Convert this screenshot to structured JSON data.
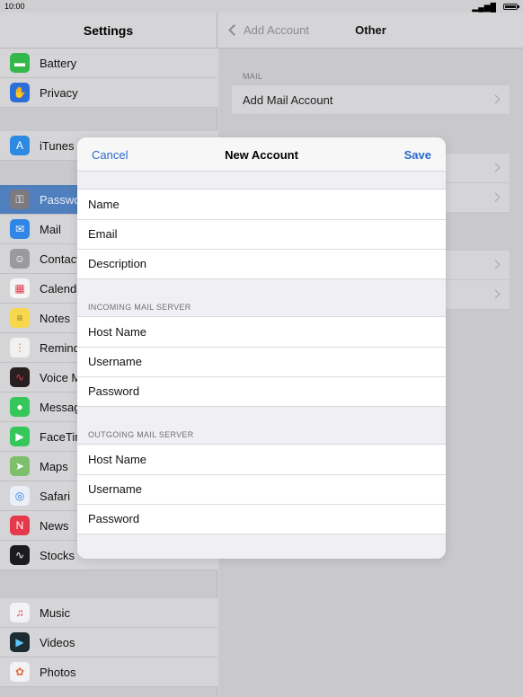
{
  "status": {
    "time": "10:00",
    "signal": "▂▄▆█"
  },
  "left": {
    "title": "Settings",
    "items": [
      {
        "label": "Battery",
        "icon": "battery-icon",
        "color": "#34b84c",
        "glyph": "▬"
      },
      {
        "label": "Privacy",
        "icon": "hand-icon",
        "color": "#2d6fd8",
        "glyph": "✋"
      },
      {
        "label": "iTunes & App Store",
        "icon": "app-store-icon",
        "color": "#2d8ae0",
        "glyph": "A"
      },
      {
        "label": "Passwords & Accounts",
        "icon": "key-icon",
        "color": "#7a7a80",
        "glyph": "⚿"
      },
      {
        "label": "Mail",
        "icon": "mail-icon",
        "color": "#2f86e6",
        "glyph": "✉"
      },
      {
        "label": "Contacts",
        "icon": "contacts-icon",
        "color": "#9a9a9e",
        "glyph": "☺"
      },
      {
        "label": "Calendar",
        "icon": "calendar-icon",
        "color": "#f4f4f4",
        "glyph": "▦"
      },
      {
        "label": "Notes",
        "icon": "notes-icon",
        "color": "#f7d74c",
        "glyph": "≡"
      },
      {
        "label": "Reminders",
        "icon": "reminders-icon",
        "color": "#f1f1f1",
        "glyph": "⋮"
      },
      {
        "label": "Voice Memos",
        "icon": "voice-memo-icon",
        "color": "#2a1f20",
        "glyph": "∿"
      },
      {
        "label": "Messages",
        "icon": "messages-icon",
        "color": "#35c759",
        "glyph": "💬"
      },
      {
        "label": "FaceTime",
        "icon": "facetime-icon",
        "color": "#35c759",
        "glyph": "▶"
      },
      {
        "label": "Maps",
        "icon": "maps-icon",
        "color": "#7dbf6a",
        "glyph": "➤"
      },
      {
        "label": "Safari",
        "icon": "safari-icon",
        "color": "#e9eef7",
        "glyph": "◎"
      },
      {
        "label": "News",
        "icon": "news-icon",
        "color": "#e5384a",
        "glyph": "N"
      },
      {
        "label": "Stocks",
        "icon": "stocks-icon",
        "color": "#1c1c1e",
        "glyph": "∿"
      },
      {
        "label": "Music",
        "icon": "music-icon",
        "color": "#f3f3f5",
        "glyph": "♫"
      },
      {
        "label": "Videos",
        "icon": "videos-icon",
        "color": "#1d2b33",
        "glyph": "▶"
      },
      {
        "label": "Photos",
        "icon": "photos-icon",
        "color": "#f3f3f5",
        "glyph": "✿"
      }
    ]
  },
  "right": {
    "back_label": "Add Account",
    "title": "Other",
    "mail_section": "MAIL",
    "add_mail_account": "Add Mail Account"
  },
  "modal": {
    "cancel": "Cancel",
    "title": "New Account",
    "save": "Save",
    "account": [
      {
        "placeholder": "Name"
      },
      {
        "placeholder": "Email"
      },
      {
        "placeholder": "Description"
      }
    ],
    "incoming_label": "INCOMING MAIL SERVER",
    "incoming": [
      {
        "placeholder": "Host Name"
      },
      {
        "placeholder": "Username"
      },
      {
        "placeholder": "Password"
      }
    ],
    "outgoing_label": "OUTGOING MAIL SERVER",
    "outgoing": [
      {
        "placeholder": "Host Name"
      },
      {
        "placeholder": "Username"
      },
      {
        "placeholder": "Password"
      }
    ]
  }
}
